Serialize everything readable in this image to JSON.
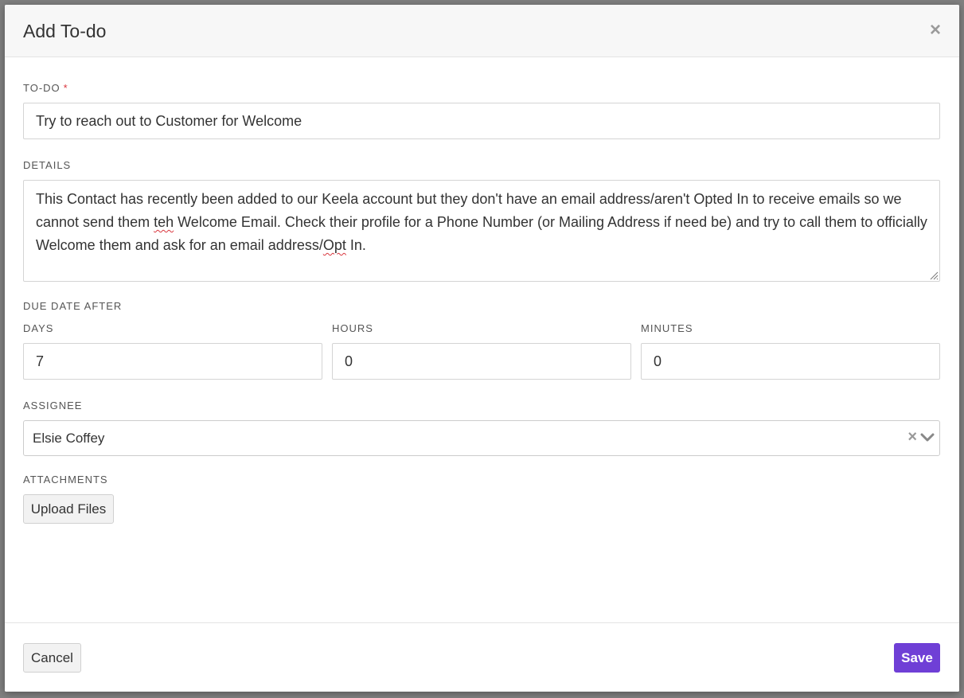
{
  "modal": {
    "title": "Add To-do",
    "close_label": "×"
  },
  "todo": {
    "label": "TO-DO",
    "required_marker": "*",
    "value": "Try to reach out to Customer for Welcome"
  },
  "details": {
    "label": "DETAILS",
    "text_part1": "This Contact has recently been added to our Keela account but they don't have an email address/aren't Opted In to receive emails so we cannot send them ",
    "misspelled_1": "teh",
    "text_part2": " Welcome Email. Check their profile for a Phone Number (or Mailing Address if need be) and try to call them to officially Welcome them and ask for an email address/",
    "misspelled_2": "Opt",
    "text_part3": " In."
  },
  "due_date": {
    "label": "DUE DATE AFTER",
    "days_label": "DAYS",
    "days_value": "7",
    "hours_label": "HOURS",
    "hours_value": "0",
    "minutes_label": "MINUTES",
    "minutes_value": "0"
  },
  "assignee": {
    "label": "ASSIGNEE",
    "selected": "Elsie Coffey",
    "clear_label": "×"
  },
  "attachments": {
    "label": "ATTACHMENTS",
    "upload_label": "Upload Files"
  },
  "footer": {
    "cancel_label": "Cancel",
    "save_label": "Save"
  },
  "colors": {
    "primary": "#6f3fd6",
    "required": "#d9363e"
  }
}
